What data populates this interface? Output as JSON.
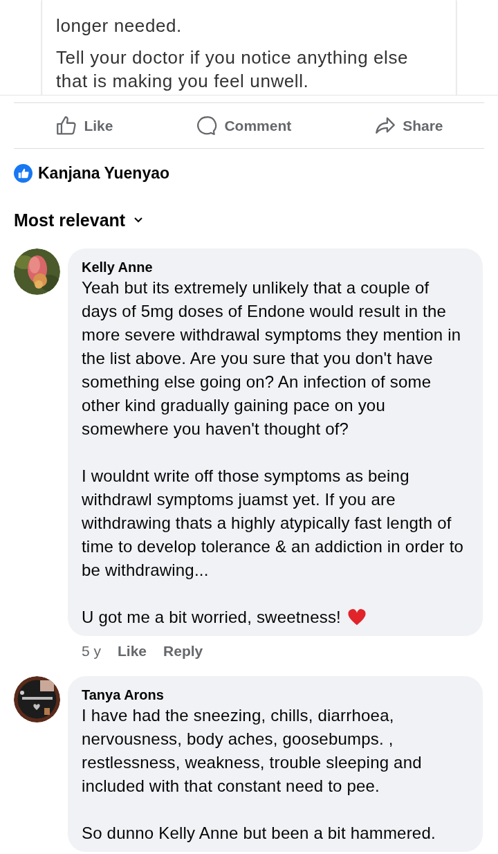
{
  "article": {
    "paragraphs": [
      "longer needed.",
      "Tell your doctor if you notice anything else that is making you feel unwell."
    ]
  },
  "actions": [
    {
      "kind": "like",
      "label": "Like"
    },
    {
      "kind": "comment",
      "label": "Comment"
    },
    {
      "kind": "share",
      "label": "Share"
    }
  ],
  "reactions": {
    "names": "Kanjana Yuenyao"
  },
  "sort": {
    "label": "Most relevant"
  },
  "comments": [
    {
      "author": "Kelly Anne",
      "avatar": {
        "kind": "picture"
      },
      "paragraphs": [
        "Yeah but its extremely unlikely that a couple of days of 5mg doses of Endone would result in the more severe withdrawal symptoms they mention in the list above. Are you sure that you don't have something else going on? An infection of some other kind gradually gaining pace on you somewhere you haven't thought of?",
        "I wouldnt write off those symptoms as being withdrawl symptoms juamst yet. If you are withdrawing thats a highly atypically fast length of time to develop tolerance & an addiction in order to be withdrawing...",
        "U got me a bit worried, sweetness!"
      ],
      "ends_with_heart": true,
      "time": "5 y",
      "like": "Like",
      "reply": "Reply"
    },
    {
      "author": "Tanya Arons",
      "avatar": {
        "kind": "picture"
      },
      "paragraphs": [
        "I have had the sneezing, chills, diarrhoea, nervousness, body aches, goosebumps. , restlessness, weakness, trouble sleeping and included with that constant need to pee.",
        "So dunno Kelly Anne but been a bit hammered."
      ],
      "ends_with_heart": false
    }
  ]
}
